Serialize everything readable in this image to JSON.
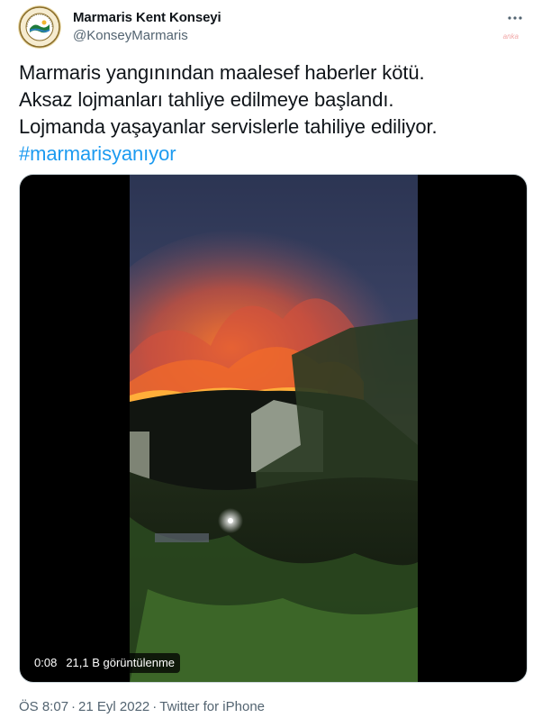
{
  "author": {
    "name": "Marmaris Kent Konseyi",
    "handle": "@KonseyMarmaris",
    "avatar_icon": "circular-logo-icon"
  },
  "watermark": "anka",
  "tweet": {
    "lines": [
      "Marmaris yangınından maalesef haberler kötü.",
      "Aksaz lojmanları tahliye edilmeye başlandı.",
      "Lojmanda yaşayanlar servislerle tahiliye ediliyor."
    ],
    "hashtag": "#marmarisyanıyor"
  },
  "video": {
    "time": "0:08",
    "views": "21,1 B görüntülenme"
  },
  "meta": {
    "time": "ÖS 8:07",
    "date": "21 Eyl 2022",
    "source": "Twitter for iPhone",
    "separator": "·"
  },
  "colors": {
    "accent": "#1d9bf0",
    "secondary_text": "#536471",
    "fire": "#ff5a1a"
  }
}
